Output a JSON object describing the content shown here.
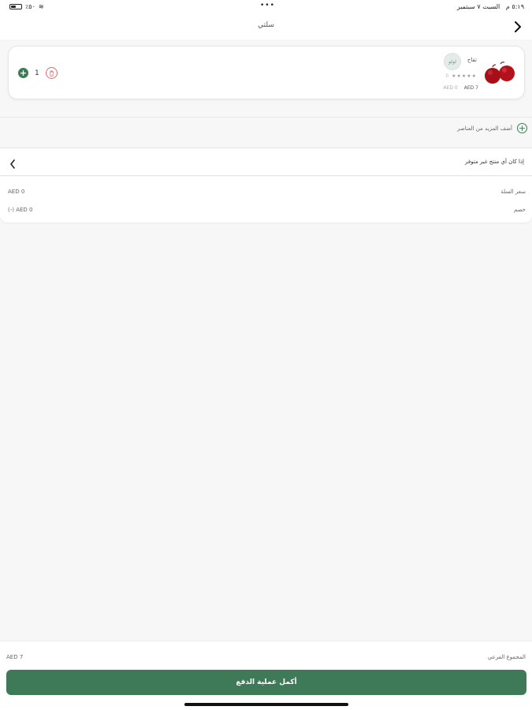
{
  "status_bar": {
    "time": "٥:١٩ م",
    "date": "السبت ٧ سبتمبر",
    "battery": "٪٥٠",
    "dots": "•••"
  },
  "nav": {
    "title": "سلتي"
  },
  "product": {
    "name": "تفاح",
    "vendor_badge": "لولو",
    "rating_count": "0",
    "stars": "★★★★★",
    "old_price": "AED 0",
    "price": "AED 7",
    "quantity": "1"
  },
  "add_more": {
    "label": "أضف المزيد من العناصر"
  },
  "unavailable": {
    "label": "إذا كان أي منتج غير متوفر"
  },
  "summary": {
    "basket_label": "سعر السلة",
    "basket_value": "AED 0",
    "discount_label": "خصم",
    "discount_value": "(-) AED 0"
  },
  "bottom": {
    "subtotal_label": "المجموع الفرعي",
    "subtotal_value": "AED 7",
    "checkout_label": "أكمل عملية الدفع"
  },
  "colors": {
    "accent": "#3e7a58",
    "delete": "#e26a6a"
  }
}
